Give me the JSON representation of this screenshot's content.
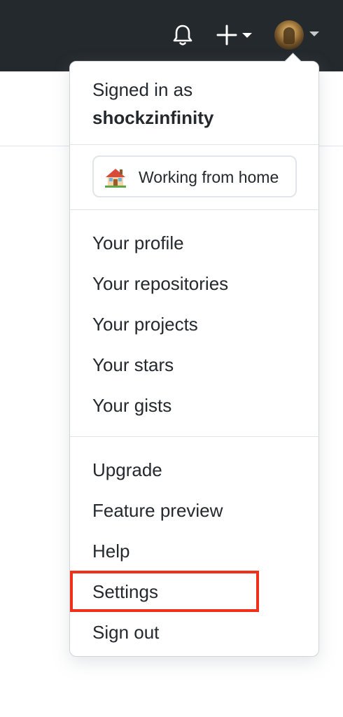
{
  "header": {
    "notifications_icon": "bell-icon",
    "create_icon": "plus-icon",
    "create_caret_icon": "caret-down-icon",
    "avatar_caret_icon": "caret-down-icon"
  },
  "menu": {
    "signed_in_label": "Signed in as",
    "username": "shockzinfinity",
    "status": {
      "emoji": "house-emoji",
      "text": "Working from home"
    },
    "group_one": [
      {
        "label": "Your profile"
      },
      {
        "label": "Your repositories"
      },
      {
        "label": "Your projects"
      },
      {
        "label": "Your stars"
      },
      {
        "label": "Your gists"
      }
    ],
    "group_two": [
      {
        "label": "Upgrade"
      },
      {
        "label": "Feature preview"
      },
      {
        "label": "Help"
      },
      {
        "label": "Settings"
      },
      {
        "label": "Sign out"
      }
    ]
  },
  "colors": {
    "header_bg": "#24292e",
    "text": "#24292e",
    "border": "#e1e4e8",
    "highlight": "#f0301a"
  }
}
